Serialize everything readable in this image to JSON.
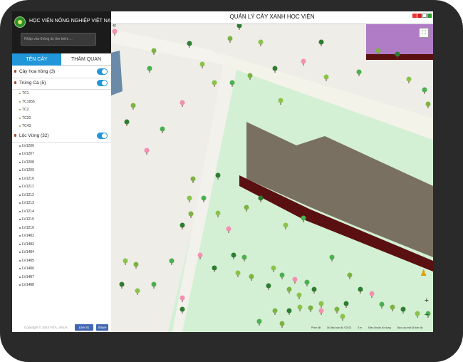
{
  "sidebar": {
    "org_name": "HỌC VIỆN NÔNG NGHIỆP VIỆT NAM",
    "search_placeholder": "Nhập vào thông tin tìm kiếm ...",
    "tabs": [
      {
        "label": "TÊN CÂY",
        "active": true
      },
      {
        "label": "THĂM QUAN",
        "active": false
      }
    ],
    "groups": [
      {
        "label": "Cây hoa hồng (3)",
        "enabled": true,
        "items": [],
        "dot_color": "#a0522d"
      },
      {
        "label": "Trứng Cá (5)",
        "enabled": true,
        "dot_color": "#9c8f2a",
        "items": [
          "TC1",
          "TC1656",
          "TC2",
          "TC20",
          "TC43"
        ]
      },
      {
        "label": "Lộc Vừng (32)",
        "enabled": true,
        "dot_color": "#555",
        "items": [
          "LV1206",
          "LV1207",
          "LV1208",
          "LV1209",
          "LV1210",
          "LV1211",
          "LV1212",
          "LV1213",
          "LV1214",
          "LV1215",
          "LV1216",
          "LV1482",
          "LV1483",
          "LV1484",
          "LV1485",
          "LV1486",
          "LV1487",
          "LV1488"
        ]
      }
    ],
    "footer": {
      "copyright": "Copyright © 2016 FITA, VNUA",
      "like_label": "Like 91",
      "share_label": "Share"
    }
  },
  "map": {
    "title": "QUẢN LÝ CÂY XANH HỌC VIỆN",
    "attribution": [
      "Phím tắt",
      "Dữ liệu bản đồ ©2022",
      "5 m",
      "Điều khoản sử dụng",
      "Báo cáo một lỗi bản đồ"
    ],
    "colors": {
      "grass": "#d4f0d4",
      "path": "#ecebe3",
      "ground": "#eeede8",
      "building": "#7a7062",
      "building_side": "#5a1010",
      "purple_roof": "#b07cc6"
    }
  }
}
